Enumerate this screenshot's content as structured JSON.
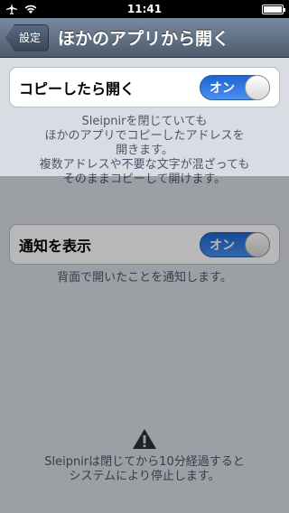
{
  "status_bar": {
    "time": "11:41"
  },
  "nav": {
    "back_label": "設定",
    "title": "ほかのアプリから開く"
  },
  "section1": {
    "label": "コピーしたら開く",
    "toggle": "オン",
    "description": "Sleipnirを閉じていても\nほかのアプリでコピーしたアドレスを\n開きます。\n複数アドレスや不要な文字が混ざっても\nそのままコピーして開けます。"
  },
  "section2": {
    "label": "通知を表示",
    "toggle": "オン",
    "description": "背面で開いたことを通知します。"
  },
  "warning": {
    "text": "Sleipnirは閉じてから10分経過すると\nシステムにより停止します。"
  },
  "colors": {
    "toggle_on": "#2f76e0",
    "nav_bar": "#5e6c7e"
  }
}
